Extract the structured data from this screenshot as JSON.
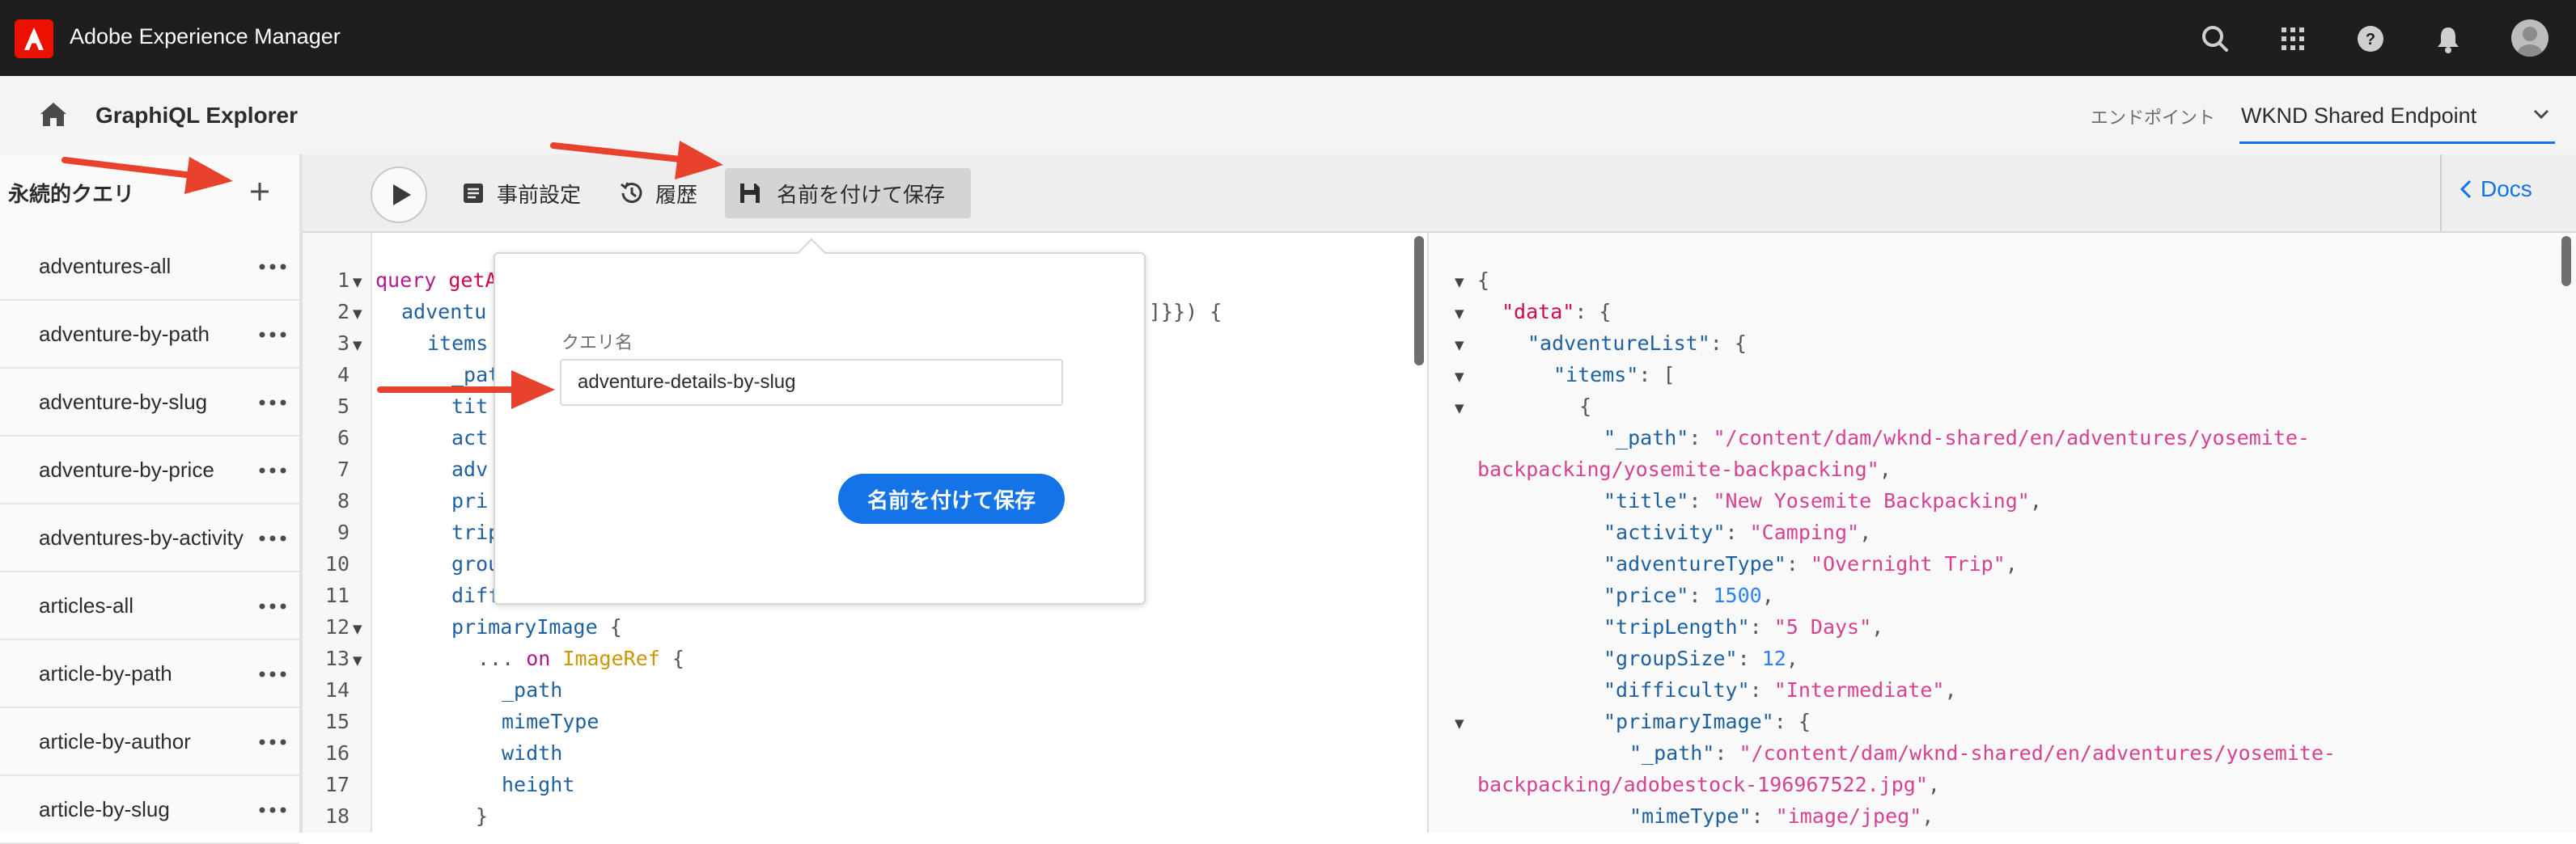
{
  "app": {
    "title": "Adobe Experience Manager"
  },
  "header": {
    "page_title": "GraphiQL Explorer",
    "endpoint_label": "エンドポイント",
    "endpoint_value": "WKND Shared Endpoint"
  },
  "sidebar": {
    "title": "永続的クエリ",
    "items": [
      {
        "label": "adventures-all"
      },
      {
        "label": "adventure-by-path"
      },
      {
        "label": "adventure-by-slug"
      },
      {
        "label": "adventure-by-price"
      },
      {
        "label": "adventures-by-activity"
      },
      {
        "label": "articles-all"
      },
      {
        "label": "article-by-path"
      },
      {
        "label": "article-by-author"
      },
      {
        "label": "article-by-slug"
      }
    ]
  },
  "toolbar": {
    "prettify_label": "事前設定",
    "history_label": "履歴",
    "save_as_label": "名前を付けて保存",
    "docs_label": "Docs"
  },
  "editor": {
    "line_numbers": [
      "1",
      "2",
      "3",
      "4",
      "5",
      "6",
      "7",
      "8",
      "9",
      "10",
      "11",
      "12",
      "13",
      "14",
      "15",
      "16",
      "17",
      "18"
    ],
    "line1_kw": "query",
    "line1_name": "getA",
    "line2_field": "adventu",
    "line2_tail": "]}}) {",
    "line3_field": "items",
    "line4_field": "_pat",
    "line5_field": "tit",
    "line6_field": "act",
    "line7_field": "adv",
    "line8_field": "pri",
    "line9_field": "trip",
    "line10_field": "grou",
    "line11_field": "diffi",
    "line12_field": "primaryImage",
    "line12_brace": "{",
    "line13_dots": "...",
    "line13_on": "on",
    "line13_type": "ImageRef",
    "line13_brace": "{",
    "line14_field": "_path",
    "line15_field": "mimeType",
    "line16_field": "width",
    "line17_field": "height",
    "line18_brace": "}"
  },
  "popover": {
    "field_label": "クエリ名",
    "input_value": "adventure-details-by-slug",
    "save_button": "名前を付けて保存"
  },
  "result": {
    "l1": "{",
    "l2_key": "\"data\"",
    "l2_rest": ": {",
    "l3_key": "\"adventureList\"",
    "l3_rest": ": {",
    "l4_key": "\"items\"",
    "l4_rest": ": [",
    "l5": "{",
    "l6_key": "\"_path\"",
    "l6_sep": ": ",
    "l6_val": "\"/content/dam/wknd-shared/en/adventures/yosemite-",
    "l7_val": "backpacking/yosemite-backpacking\"",
    "l7_rest": ",",
    "l8_key": "\"title\"",
    "l8_sep": ": ",
    "l8_val": "\"New Yosemite Backpacking\"",
    "l8_rest": ",",
    "l9_key": "\"activity\"",
    "l9_sep": ": ",
    "l9_val": "\"Camping\"",
    "l9_rest": ",",
    "l10_key": "\"adventureType\"",
    "l10_sep": ": ",
    "l10_val": "\"Overnight Trip\"",
    "l10_rest": ",",
    "l11_key": "\"price\"",
    "l11_sep": ": ",
    "l11_val": "1500",
    "l11_rest": ",",
    "l12_key": "\"tripLength\"",
    "l12_sep": ": ",
    "l12_val": "\"5 Days\"",
    "l12_rest": ",",
    "l13_key": "\"groupSize\"",
    "l13_sep": ": ",
    "l13_val": "12",
    "l13_rest": ",",
    "l14_key": "\"difficulty\"",
    "l14_sep": ": ",
    "l14_val": "\"Intermediate\"",
    "l14_rest": ",",
    "l15_key": "\"primaryImage\"",
    "l15_rest": ": {",
    "l16_key": "\"_path\"",
    "l16_sep": ": ",
    "l16_val": "\"/content/dam/wknd-shared/en/adventures/yosemite-",
    "l17_val": "backpacking/adobestock-196967522.jpg\"",
    "l17_rest": ",",
    "l18_key": "\"mimeType\"",
    "l18_sep": ": ",
    "l18_val": "\"image/jpeg\"",
    "l18_rest": ","
  },
  "colors": {
    "topbar": "#1e1e1e",
    "accent": "#1473e6",
    "adobe_red": "#eb1000",
    "annotation_arrow": "#e8412c"
  },
  "icons": [
    "adobe-logo-icon",
    "search-icon",
    "apps-grid-icon",
    "help-icon",
    "bell-icon",
    "avatar",
    "home-icon",
    "chevron-down-icon",
    "plus-icon",
    "more-icon",
    "play-icon",
    "prettify-icon",
    "history-icon",
    "save-icon",
    "chevron-left-icon"
  ]
}
